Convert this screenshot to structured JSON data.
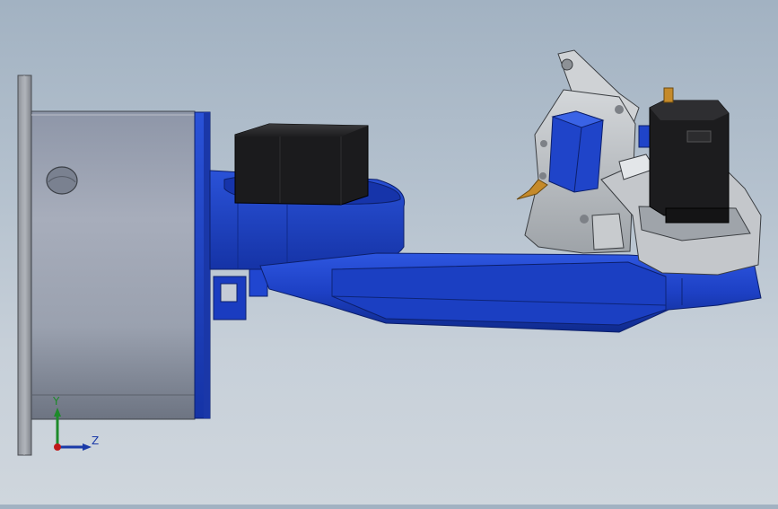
{
  "viewport": {
    "background_top": "#a2b2c2",
    "background_bottom": "#cfd6dd"
  },
  "model": {
    "part_color_blue": "#1f44c9",
    "part_color_grey": "#bfc3c8",
    "servo_color": "#1c1c1c",
    "cylinder_color": "#8f97a6"
  },
  "triad": {
    "y_label": "Y",
    "z_label": "Z",
    "y_color": "#1d8a2a",
    "z_color": "#1a3aa8",
    "x_color": "#c01818"
  }
}
